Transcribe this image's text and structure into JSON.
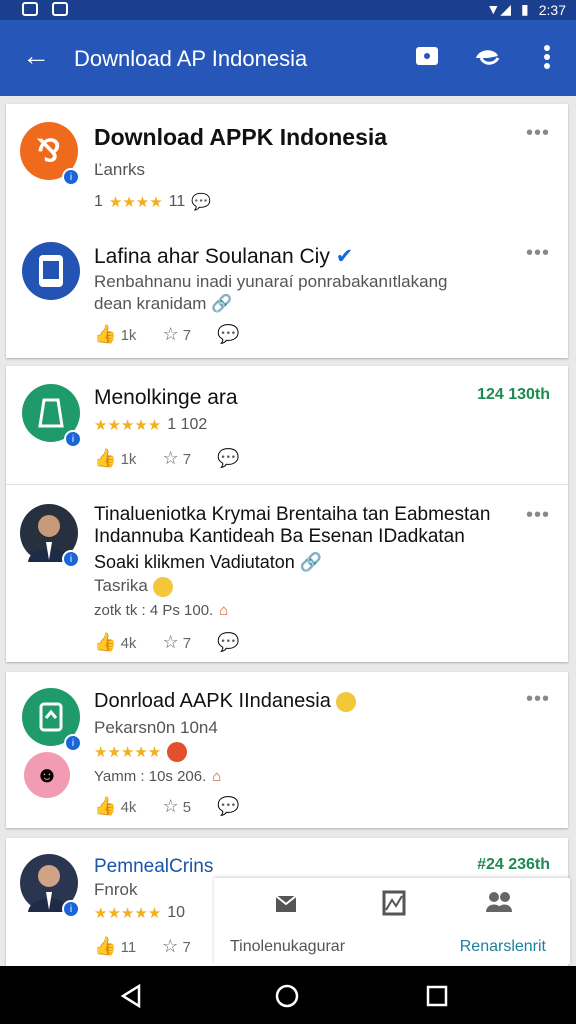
{
  "status_bar": {
    "time": "2:37",
    "battery_icon": "battery-icon",
    "signal_icon": "signal-icon"
  },
  "app_bar": {
    "title": "Download AP Indonesia"
  },
  "posts": [
    {
      "title": "Download APPK Indonesia",
      "sub": "Ľanrks",
      "rating_prefix": "1",
      "stars": "★★★★",
      "rating_count": "11"
    },
    {
      "title": "Lafina ahar Soulanan Ciy",
      "body1": "Renbahnanu inadi yunaraí ponrabakanıtlakang",
      "body2": "dean kranidam",
      "likes": "1k",
      "stars": "7"
    },
    {
      "title": "Menolkinge ara",
      "time": "124 130th",
      "stars": "★★★★★",
      "rating_count": "1 102",
      "likes": "1k",
      "shares": "7"
    },
    {
      "title1": "Tinalueniotka Krymai Brentaiha tan Eabmestan",
      "title2": "Indannuba Kantideah Ba Esenan IDadkatan",
      "title3": "Soaki klikmen Vadiutaton",
      "sub": "Tasrika",
      "meta": "zotk tk : 4 Ps 100.",
      "likes": "4k",
      "stars": "7"
    },
    {
      "title": "Donrload AAPK IIndanesia",
      "sub": "Pekarsn0n 10n4",
      "stars": "★★★★★",
      "meta": "Yamm  : 10s 206.",
      "likes": "4k",
      "shares": "5"
    },
    {
      "title": "PemnealCrins",
      "sub": "Fnrok",
      "time": "#24 236th",
      "stars": "★★★★★",
      "rating_count": "10",
      "likes": "11",
      "shares": "7"
    }
  ],
  "bottom_sheet": {
    "left_label": "Tinolenukagurar",
    "right_label": "Renarslenrit"
  }
}
